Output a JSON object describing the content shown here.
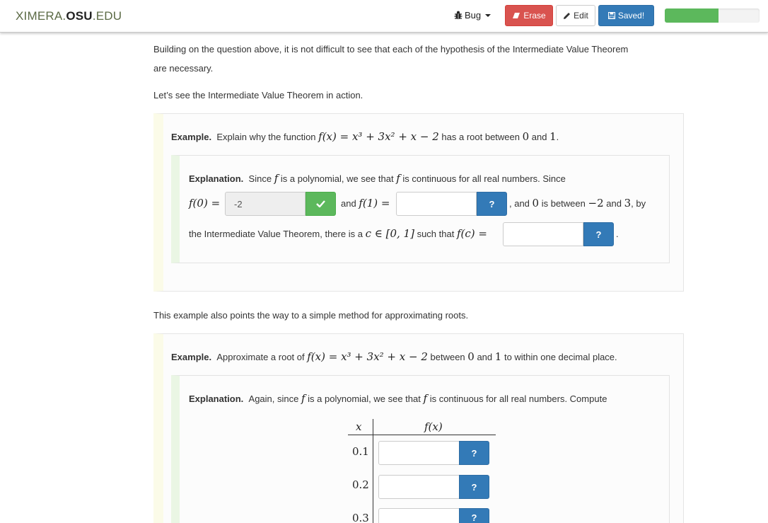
{
  "navbar": {
    "brand_prefix": "XIMERA.",
    "brand_bold": "OSU",
    "brand_suffix": ".EDU",
    "bug_label": "Bug",
    "erase_label": "Erase",
    "edit_label": "Edit",
    "saved_label": "Saved!",
    "progress_fraction": 0.57,
    "colors": {
      "erase": "#d9534f",
      "saved": "#337ab7",
      "progress": "#5cb85c"
    }
  },
  "content": {
    "intro_line1": "Building on the question above, it is not difficult to see that each of the hypothesis of the Intermediate Value Theorem",
    "intro_line2": "are necessary.",
    "lets_see": "Let’s see the Intermediate Value Theorem in action.",
    "example1": {
      "label": "Example.",
      "text_a": "Explain why the function",
      "math_f": "f(x) = x³ + 3x² + x − 2",
      "text_b": "has a root between",
      "zero": "0",
      "and": "and",
      "one": "1",
      "period": ".",
      "explanation": {
        "label": "Explanation.",
        "line1_a": "Since",
        "f": "f",
        "line1_b": "is a polynomial, we see that",
        "line1_c": "is continuous for all real numbers. Since",
        "f0": "f(0) =",
        "f0_value": "-2",
        "and_text": "and",
        "f1": "f(1) =",
        "f1_value": "",
        "after_f1_a": ", and",
        "after_f1_zero": "0",
        "after_f1_b": "is between",
        "neg2": "−2",
        "after_f1_c": "and",
        "three": "3",
        "after_f1_d": ", by",
        "line3_a": "the Intermediate Value Theorem, there is a",
        "c_in": "c ∈ [0, 1]",
        "line3_b": "such that",
        "fc": "f(c) =",
        "fc_value": "",
        "line3_end": ".",
        "hint_label": "?"
      }
    },
    "middle_text": "This example also points the way to a simple method for approximating roots.",
    "example2": {
      "label": "Example.",
      "text_a": "Approximate a root of",
      "math_f": "f(x) = x³ + 3x² + x − 2",
      "text_b": "between",
      "zero": "0",
      "and": "and",
      "one": "1",
      "text_c": "to within one decimal place.",
      "explanation": {
        "label": "Explanation.",
        "text_a": "Again, since",
        "f": "f",
        "text_b": "is a polynomial, we see that",
        "text_c": "is continuous for all real numbers. Compute",
        "table": {
          "col_x": "x",
          "col_fx": "f(x)",
          "rows": [
            {
              "x": "0.1",
              "value": ""
            },
            {
              "x": "0.2",
              "value": ""
            },
            {
              "x": "0.3",
              "value": ""
            }
          ],
          "hint_label": "?"
        }
      }
    }
  }
}
